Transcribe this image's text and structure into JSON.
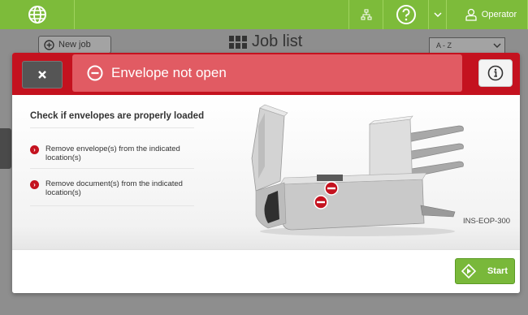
{
  "topbar": {
    "operator_label": "Operator"
  },
  "background": {
    "new_job_label": "New job",
    "title": "Job list",
    "sort_value": "A - Z"
  },
  "modal": {
    "error_title": "Envelope not open",
    "check_title": "Check if envelopes are properly loaded",
    "items": [
      {
        "label": "Remove envelope(s) from the indicated location(s)"
      },
      {
        "label": "Remove document(s) from the indicated location(s)"
      }
    ],
    "image_code": "INS-EOP-300",
    "start_label": "Start"
  },
  "colors": {
    "accent_green": "#7dbb3a",
    "error_red": "#c4121f",
    "error_banner": "#e15b63"
  }
}
